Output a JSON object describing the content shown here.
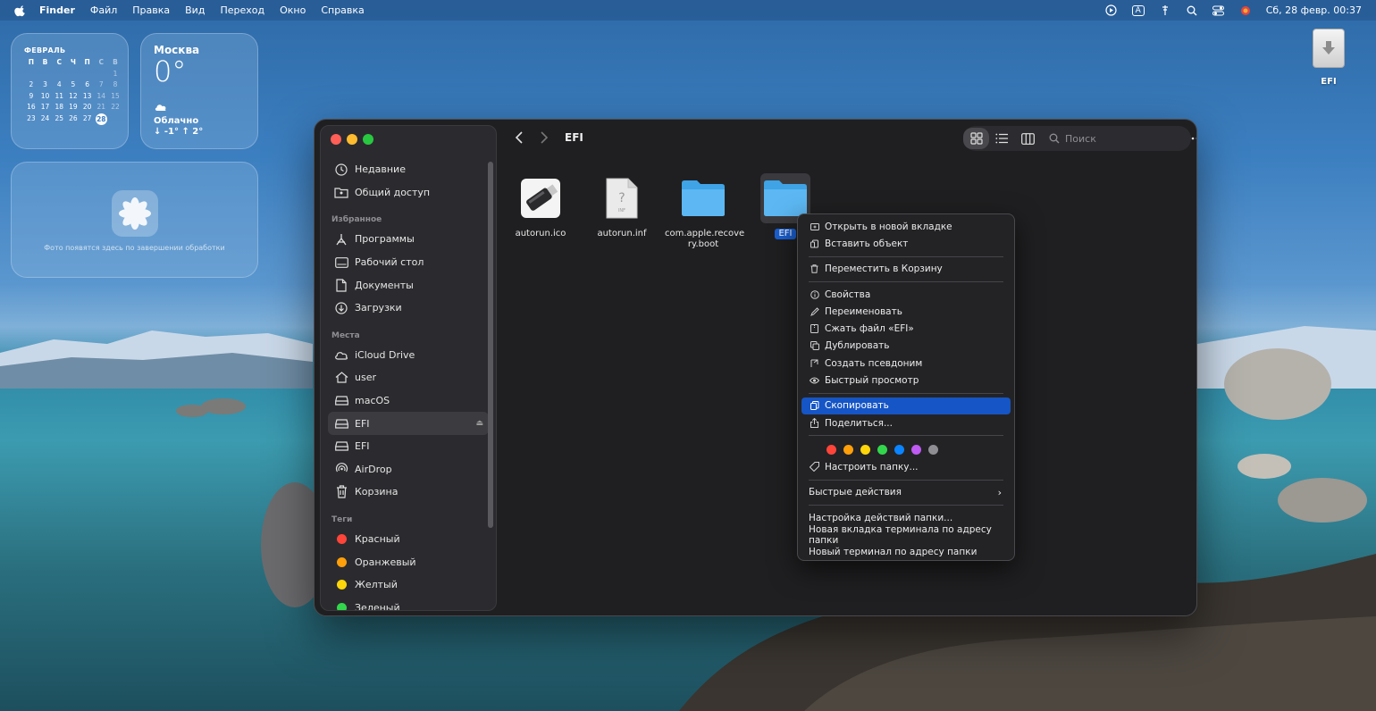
{
  "menubar": {
    "app": "Finder",
    "items": [
      "Файл",
      "Правка",
      "Вид",
      "Переход",
      "Окно",
      "Справка"
    ],
    "input_badge": "A",
    "clock": "Сб, 28 февр.  00:37"
  },
  "calendar": {
    "month": "ФЕВРАЛЬ",
    "weekdays": [
      "П",
      "В",
      "С",
      "Ч",
      "П",
      "С",
      "В"
    ],
    "rows": [
      [
        "",
        "",
        "",
        "",
        "",
        "",
        "1"
      ],
      [
        "2",
        "3",
        "4",
        "5",
        "6",
        "7",
        "8"
      ],
      [
        "9",
        "10",
        "11",
        "12",
        "13",
        "14",
        "15"
      ],
      [
        "16",
        "17",
        "18",
        "19",
        "20",
        "21",
        "22"
      ],
      [
        "23",
        "24",
        "25",
        "26",
        "27",
        "28",
        ""
      ]
    ],
    "today": "28"
  },
  "weather": {
    "city": "Москва",
    "temp": "0°",
    "condition": "Облачно",
    "range": "↓ -1° ↑ 2°"
  },
  "photos": {
    "text": "Фото появятся здесь по завершении обработки"
  },
  "desktop_drive": {
    "label": "EFI"
  },
  "sidebar": {
    "top": [
      {
        "label": "Недавние",
        "icon": "clock-icon"
      },
      {
        "label": "Общий доступ",
        "icon": "shared-folder-icon"
      }
    ],
    "favorites_header": "Избранное",
    "favorites": [
      {
        "label": "Программы",
        "icon": "apps-icon"
      },
      {
        "label": "Рабочий стол",
        "icon": "desktop-icon"
      },
      {
        "label": "Документы",
        "icon": "document-icon"
      },
      {
        "label": "Загрузки",
        "icon": "download-icon"
      }
    ],
    "places_header": "Места",
    "places": [
      {
        "label": "iCloud Drive",
        "icon": "cloud-icon"
      },
      {
        "label": "user",
        "icon": "home-icon"
      },
      {
        "label": "macOS",
        "icon": "disk-icon"
      },
      {
        "label": "EFI",
        "icon": "disk-icon"
      },
      {
        "label": "EFI",
        "icon": "disk-icon"
      },
      {
        "label": "AirDrop",
        "icon": "airdrop-icon"
      },
      {
        "label": "Корзина",
        "icon": "trash-icon"
      }
    ],
    "tags_header": "Теги",
    "tags": [
      {
        "label": "Красный",
        "color": "#ff453a"
      },
      {
        "label": "Оранжевый",
        "color": "#ff9f0a"
      },
      {
        "label": "Желтый",
        "color": "#ffd60a"
      },
      {
        "label": "Зеленый",
        "color": "#32d74b"
      }
    ]
  },
  "toolbar": {
    "title": "EFI",
    "search_placeholder": "Поиск"
  },
  "files": [
    {
      "name": "autorun.ico",
      "type": "usb"
    },
    {
      "name": "autorun.inf",
      "type": "inf"
    },
    {
      "name": "com.apple.recove ry.boot",
      "type": "folder"
    },
    {
      "name": "EFI",
      "type": "folder",
      "selected": true
    }
  ],
  "context_menu": {
    "items": [
      "Открыть в новой вкладке",
      "Вставить объект",
      "Переместить в Корзину",
      "Свойства",
      "Переименовать",
      "Сжать файл «EFI»",
      "Дублировать",
      "Создать псевдоним",
      "Быстрый просмотр",
      "Скопировать",
      "Поделиться...",
      "Настроить папку...",
      "Быстрые действия",
      "Настройка действий папки...",
      "Новая вкладка терминала по адресу папки",
      "Новый терминал по адресу папки"
    ],
    "highlighted": "Скопировать",
    "tag_colors": [
      "#ff453a",
      "#ff9f0a",
      "#ffd60a",
      "#32d74b",
      "#0a84ff",
      "#bf5af2",
      "#8e8e93"
    ]
  }
}
